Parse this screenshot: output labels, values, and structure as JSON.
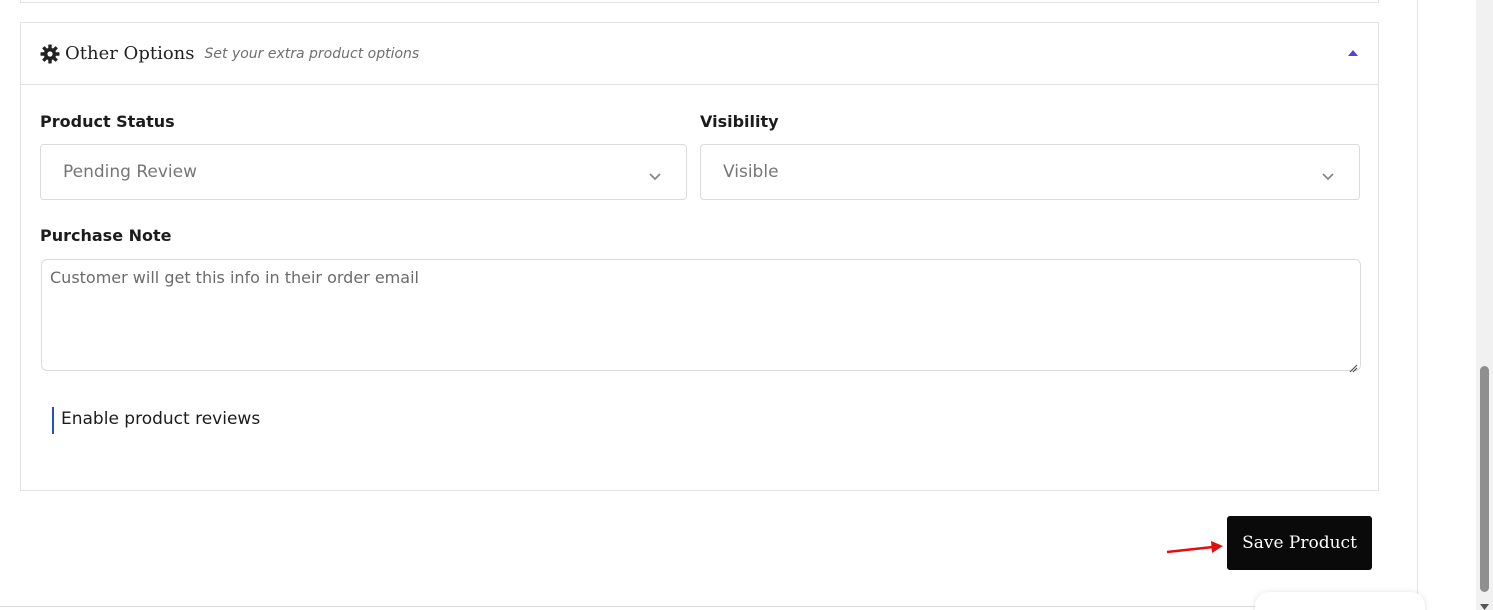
{
  "section": {
    "title": "Other Options",
    "subtitle": "Set your extra product options",
    "accent_color": "#5b3fd9"
  },
  "fields": {
    "product_status": {
      "label": "Product Status",
      "value": "Pending Review"
    },
    "visibility": {
      "label": "Visibility",
      "value": "Visible"
    },
    "purchase_note": {
      "label": "Purchase Note",
      "placeholder": "Customer will get this info in their order email"
    },
    "reviews": {
      "label": "Enable product reviews",
      "accent_color": "#2b4bd0"
    }
  },
  "actions": {
    "save_label": "Save Product"
  },
  "icons": [
    "gear-icon",
    "caret-up-icon",
    "chevron-down-icon",
    "resize-handle-icon",
    "arrow-right-icon"
  ]
}
